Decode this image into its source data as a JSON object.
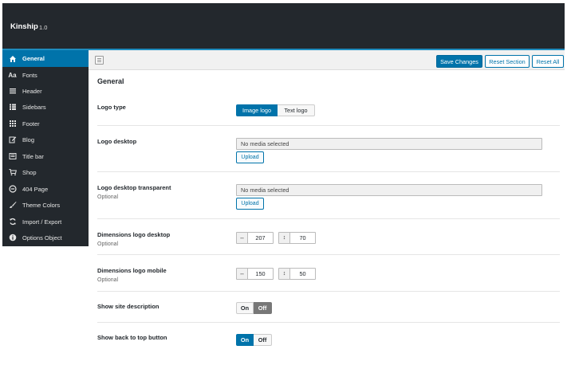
{
  "app": {
    "title": "Kinship",
    "version": "1.0"
  },
  "sidebar": {
    "items": [
      {
        "label": "General",
        "icon": "home-icon",
        "active": true
      },
      {
        "label": "Fonts",
        "icon": "font-icon"
      },
      {
        "label": "Header",
        "icon": "menu-icon"
      },
      {
        "label": "Sidebars",
        "icon": "list-icon"
      },
      {
        "label": "Footer",
        "icon": "grid-icon"
      },
      {
        "label": "Blog",
        "icon": "edit-icon"
      },
      {
        "label": "Title bar",
        "icon": "titlebar-icon"
      },
      {
        "label": "Shop",
        "icon": "cart-icon"
      },
      {
        "label": "404 Page",
        "icon": "minus-circle-icon"
      },
      {
        "label": "Theme Colors",
        "icon": "brush-icon"
      },
      {
        "label": "Import / Export",
        "icon": "refresh-icon"
      },
      {
        "label": "Options Object",
        "icon": "info-icon"
      }
    ]
  },
  "toolbar": {
    "save_label": "Save Changes",
    "reset_section_label": "Reset Section",
    "reset_all_label": "Reset All"
  },
  "section": {
    "title": "General"
  },
  "fields": {
    "logo_type": {
      "label": "Logo type",
      "options": [
        "Image logo",
        "Text logo"
      ],
      "selected": "Image logo"
    },
    "logo_desktop": {
      "label": "Logo desktop",
      "value": "No media selected",
      "upload_label": "Upload"
    },
    "logo_desktop_transparent": {
      "label": "Logo desktop transparent",
      "desc": "Optional",
      "value": "No media selected",
      "upload_label": "Upload"
    },
    "dim_desktop": {
      "label": "Dimensions logo desktop",
      "desc": "Optional",
      "width": "207",
      "height": "70"
    },
    "dim_mobile": {
      "label": "Dimensions logo mobile",
      "desc": "Optional",
      "width": "150",
      "height": "50"
    },
    "show_site_description": {
      "label": "Show site description",
      "on_label": "On",
      "off_label": "Off",
      "state": "Off"
    },
    "show_back_to_top": {
      "label": "Show back to top button",
      "on_label": "On",
      "off_label": "Off",
      "state": "On"
    }
  },
  "colors": {
    "accent": "#0073aa",
    "sidebar_bg": "#23282d",
    "toolbar_bg": "#f1f1f1"
  }
}
